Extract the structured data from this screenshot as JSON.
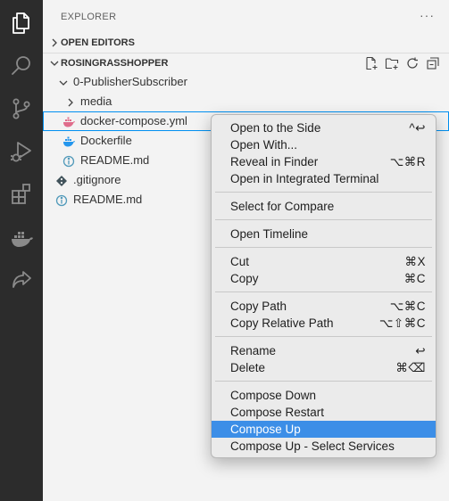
{
  "activity_bar": {
    "icons": [
      "files-icon",
      "search-icon",
      "source-control-icon",
      "run-debug-icon",
      "extensions-icon",
      "docker-icon",
      "live-share-icon"
    ]
  },
  "explorer": {
    "title": "EXPLORER",
    "more_glyph": "···",
    "open_editors_label": "OPEN EDITORS",
    "workspace_label": "ROSINGRASSHOPPER",
    "tree": {
      "folder_pubsub": "0-PublisherSubscriber",
      "folder_media": "media",
      "file_compose": "docker-compose.yml",
      "file_dockerfile": "Dockerfile",
      "file_readme_inner": "README.md",
      "file_gitignore": ".gitignore",
      "file_readme_root": "README.md"
    }
  },
  "context_menu": {
    "open_side": "Open to the Side",
    "open_side_key": "^↩",
    "open_with": "Open With...",
    "reveal": "Reveal in Finder",
    "reveal_key": "⌥⌘R",
    "open_terminal": "Open in Integrated Terminal",
    "select_compare": "Select for Compare",
    "open_timeline": "Open Timeline",
    "cut": "Cut",
    "cut_key": "⌘X",
    "copy": "Copy",
    "copy_key": "⌘C",
    "copy_path": "Copy Path",
    "copy_path_key": "⌥⌘C",
    "copy_rel_path": "Copy Relative Path",
    "copy_rel_path_key": "⌥⇧⌘C",
    "rename": "Rename",
    "rename_key": "↩",
    "delete": "Delete",
    "delete_key": "⌘⌫",
    "compose_down": "Compose Down",
    "compose_restart": "Compose Restart",
    "compose_up": "Compose Up",
    "compose_up_select": "Compose Up - Select Services"
  },
  "colors": {
    "activity_bar_bg": "#2c2c2c",
    "active_icon": "#ffffff",
    "inactive_icon": "#8a8a8a",
    "sidebar_bg": "#f3f3f3",
    "menu_bg": "#ebebeb",
    "menu_highlight": "#3c8ee7",
    "focus_border": "#0090f1",
    "docker_blue": "#2496ed",
    "compose_pink": "#e06c8b"
  }
}
